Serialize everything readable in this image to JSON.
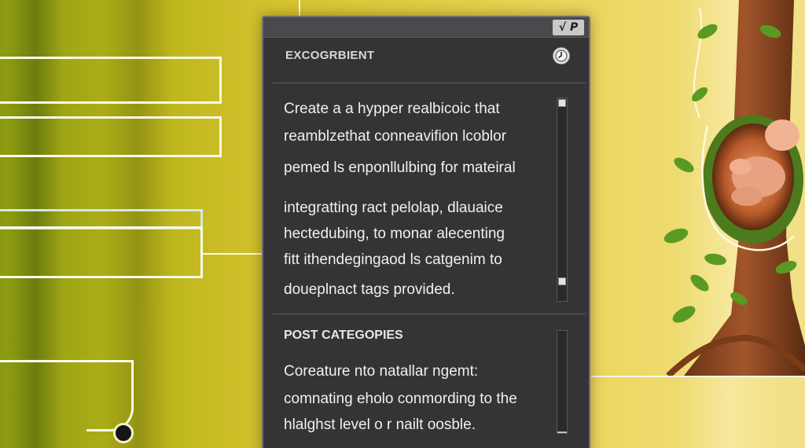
{
  "dialog": {
    "title_controls": "√ P",
    "header": "EXCOGRBIENT",
    "clock_icon": "clock-icon",
    "description_lines": [
      "Create a a hypper realbicoic that",
      "reamblzethat conneavifion lcoblor",
      "pemed ls enponllulbing for mateiral",
      "integratting ract pelolap, dlauaice",
      "hectedubing, to monar alecenting",
      "fitt ithendegingaod ls catgenim to",
      "doueplnact  tags provided."
    ],
    "post_categories": {
      "heading": "POST CATEGOPIES",
      "lines": [
        "Coreature nto natallar ngemt:",
        "comnating eholo conmording to the",
        "hlalghst level o r nailt oosble."
      ]
    }
  },
  "colors": {
    "panel_bg": "#343436",
    "backdrop_yellow": "#d7c430",
    "frame_white": "#fafae6"
  }
}
